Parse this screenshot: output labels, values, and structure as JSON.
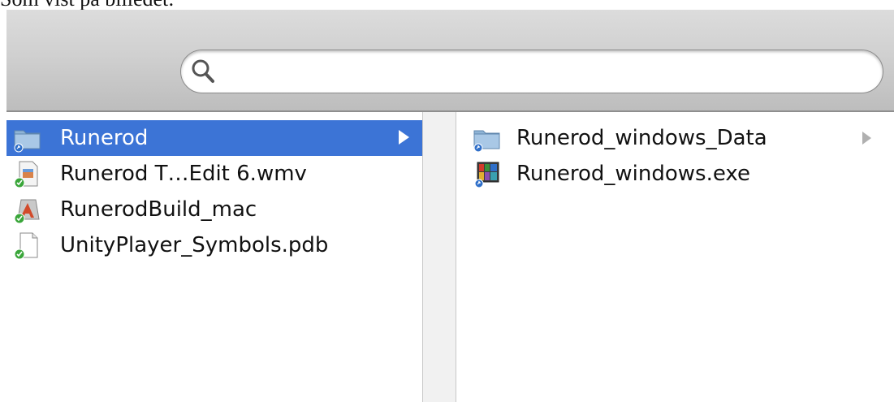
{
  "caption": "Som vist på billedet:",
  "search": {
    "value": "",
    "placeholder": ""
  },
  "left_column": {
    "items": [
      {
        "label": "Runerod",
        "icon": "folder-alias-icon",
        "selected": true,
        "has_children": true
      },
      {
        "label": "Runerod T…Edit 6.wmv",
        "icon": "video-file-icon",
        "selected": false,
        "has_children": false
      },
      {
        "label": "RunerodBuild_mac",
        "icon": "application-icon",
        "selected": false,
        "has_children": false
      },
      {
        "label": "UnityPlayer_Symbols.pdb",
        "icon": "document-file-icon",
        "selected": false,
        "has_children": false
      }
    ]
  },
  "right_column": {
    "items": [
      {
        "label": "Runerod_windows_Data",
        "icon": "folder-alias-icon",
        "has_children": true
      },
      {
        "label": "Runerod_windows.exe",
        "icon": "exe-file-icon",
        "has_children": false
      }
    ]
  },
  "colors": {
    "selection": "#3c74d6",
    "toolbar_top": "#dcdcdc",
    "toolbar_bottom": "#bdbdbd"
  }
}
